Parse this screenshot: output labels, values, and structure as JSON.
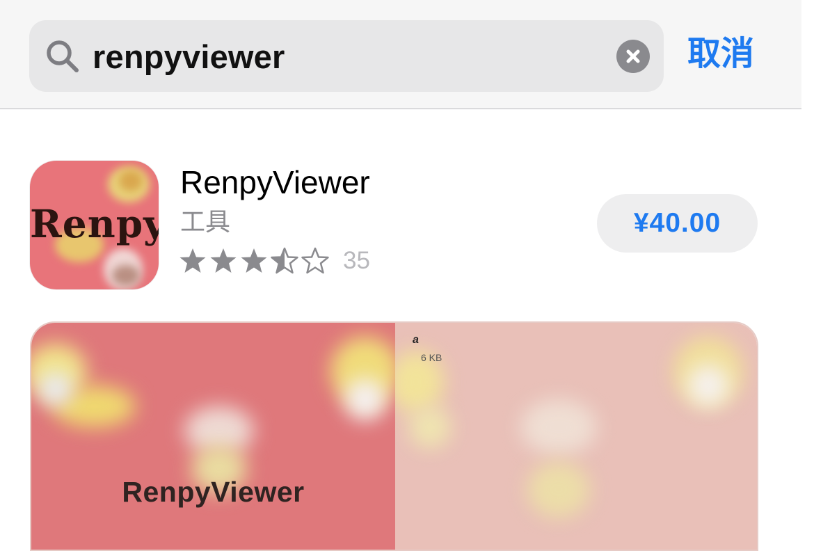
{
  "search": {
    "query": "renpyviewer",
    "cancel_label": "取消"
  },
  "result": {
    "name": "RenpyViewer",
    "category": "工具",
    "rating": 3.5,
    "rating_max": 5,
    "rating_count": "35",
    "price": "¥40.00",
    "icon_text": "Renpy"
  },
  "screenshots": [
    {
      "title": "RenpyViewer"
    },
    {
      "file_name": "a",
      "file_size": "6 KB"
    }
  ],
  "colors": {
    "accent": "#1e7af0",
    "icon_background": "#e8747a",
    "screenshot_left_bg": "#df787b",
    "screenshot_right_bg": "#e9c0b8",
    "star": "#8a8a8e"
  },
  "icons": [
    "search-icon",
    "clear-icon",
    "star-icon",
    "half-star-icon",
    "empty-star-icon"
  ]
}
